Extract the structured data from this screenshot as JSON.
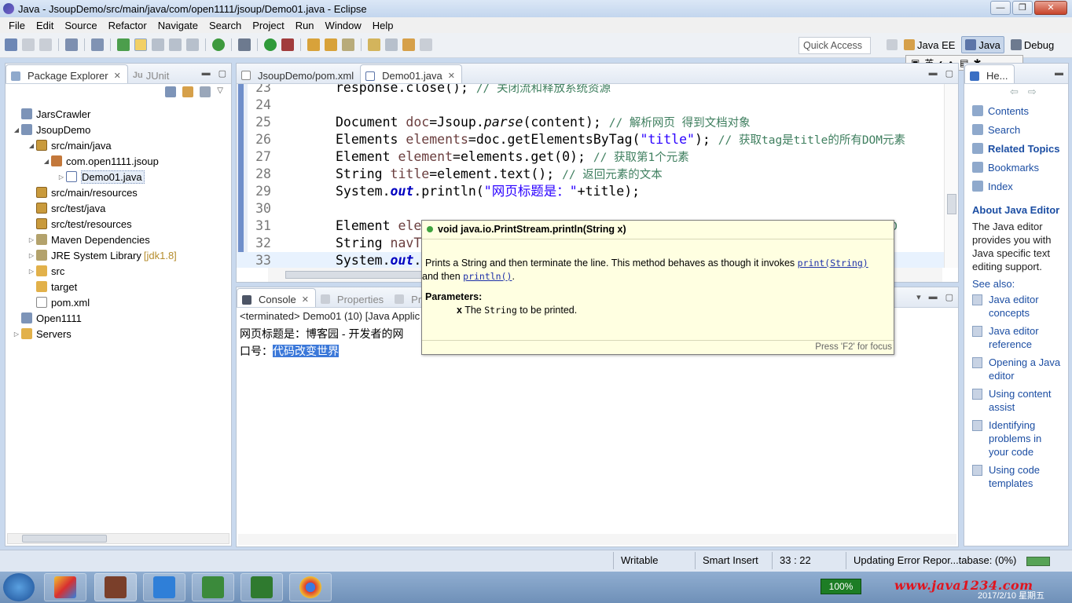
{
  "window": {
    "title": "Java - JsoupDemo/src/main/java/com/open1111/jsoup/Demo01.java - Eclipse",
    "buttons": [
      "—",
      "❐",
      "✕"
    ]
  },
  "menu": [
    "File",
    "Edit",
    "Source",
    "Refactor",
    "Navigate",
    "Search",
    "Project",
    "Run",
    "Window",
    "Help"
  ],
  "toolbar": {
    "quick_access": "Quick Access",
    "perspectives": [
      "Java EE",
      "Java",
      "Debug"
    ]
  },
  "ime": {
    "items": [
      "英"
    ]
  },
  "explorer": {
    "tabs": [
      "Package Explorer",
      "JUnit"
    ],
    "tree": [
      {
        "label": "JarsCrawler",
        "level": 0,
        "icon": "project-icon",
        "twisty": ""
      },
      {
        "label": "JsoupDemo",
        "level": 0,
        "icon": "project-icon",
        "twisty": "◢"
      },
      {
        "label": "src/main/java",
        "level": 1,
        "icon": "source-folder-icon",
        "twisty": "◢"
      },
      {
        "label": "com.open1111.jsoup",
        "level": 2,
        "icon": "package-icon",
        "twisty": "◢"
      },
      {
        "label": "Demo01.java",
        "level": 3,
        "icon": "java-file-icon",
        "twisty": "▷"
      },
      {
        "label": "src/main/resources",
        "level": 1,
        "icon": "source-folder-icon",
        "twisty": ""
      },
      {
        "label": "src/test/java",
        "level": 1,
        "icon": "source-folder-icon",
        "twisty": ""
      },
      {
        "label": "src/test/resources",
        "level": 1,
        "icon": "source-folder-icon",
        "twisty": ""
      },
      {
        "label": "Maven Dependencies",
        "level": 1,
        "icon": "library-icon",
        "twisty": "▷"
      },
      {
        "label": "JRE System Library",
        "level": 1,
        "icon": "library-icon",
        "twisty": "▷",
        "suffix": "[jdk1.8]"
      },
      {
        "label": "src",
        "level": 1,
        "icon": "folder-icon",
        "twisty": "▷"
      },
      {
        "label": "target",
        "level": 1,
        "icon": "folder-icon",
        "twisty": ""
      },
      {
        "label": "pom.xml",
        "level": 1,
        "icon": "xml-file-icon",
        "twisty": ""
      },
      {
        "label": "Open1111",
        "level": 0,
        "icon": "project-icon",
        "twisty": ""
      },
      {
        "label": "Servers",
        "level": 0,
        "icon": "folder-icon",
        "twisty": "▷"
      }
    ]
  },
  "editor": {
    "tabs": [
      "JsoupDemo/pom.xml",
      "Demo01.java"
    ],
    "lines": [
      {
        "n": "23",
        "parts": [
          {
            "t": "response.close(); ",
            "c": ""
          },
          {
            "t": "// 关闭流和释放系统资源",
            "c": "cmt"
          }
        ]
      },
      {
        "n": "24",
        "parts": []
      },
      {
        "n": "25",
        "parts": [
          {
            "t": "Document ",
            "c": ""
          },
          {
            "t": "doc",
            "c": "var"
          },
          {
            "t": "=Jsoup.",
            "c": ""
          },
          {
            "t": "parse",
            "c": "itl"
          },
          {
            "t": "(content); ",
            "c": ""
          },
          {
            "t": "// 解析网页 得到文档对象",
            "c": "cmt"
          }
        ]
      },
      {
        "n": "26",
        "parts": [
          {
            "t": "Elements ",
            "c": ""
          },
          {
            "t": "elements",
            "c": "var"
          },
          {
            "t": "=doc.getElementsByTag(",
            "c": ""
          },
          {
            "t": "\"title\"",
            "c": "kw-str"
          },
          {
            "t": "); ",
            "c": ""
          },
          {
            "t": "// 获取tag是title的所有DOM元素",
            "c": "cmt"
          }
        ]
      },
      {
        "n": "27",
        "parts": [
          {
            "t": "Element ",
            "c": ""
          },
          {
            "t": "element",
            "c": "var"
          },
          {
            "t": "=elements.get(0); ",
            "c": ""
          },
          {
            "t": "// 获取第1个元素",
            "c": "cmt"
          }
        ]
      },
      {
        "n": "28",
        "parts": [
          {
            "t": "String ",
            "c": ""
          },
          {
            "t": "title",
            "c": "var"
          },
          {
            "t": "=element.text(); ",
            "c": ""
          },
          {
            "t": "// 返回元素的文本",
            "c": "cmt"
          }
        ]
      },
      {
        "n": "29",
        "parts": [
          {
            "t": "System.",
            "c": ""
          },
          {
            "t": "out",
            "c": "static"
          },
          {
            "t": ".println(",
            "c": ""
          },
          {
            "t": "\"网页标题是：\"",
            "c": "kw-str"
          },
          {
            "t": "+title);",
            "c": ""
          }
        ]
      },
      {
        "n": "30",
        "parts": []
      },
      {
        "n": "31",
        "parts": [
          {
            "t": "Element ",
            "c": ""
          },
          {
            "t": "ele",
            "c": "var"
          },
          {
            "t": "                                                        ",
            "c": ""
          },
          {
            "t": "top的D",
            "c": "cmt"
          }
        ]
      },
      {
        "n": "32",
        "parts": [
          {
            "t": "String ",
            "c": ""
          },
          {
            "t": "navT",
            "c": "var"
          }
        ]
      },
      {
        "n": "33",
        "parts": [
          {
            "t": "System.",
            "c": ""
          },
          {
            "t": "out",
            "c": "static"
          },
          {
            "t": ".",
            "c": ""
          }
        ]
      }
    ]
  },
  "console": {
    "tabs": [
      "Console",
      "Properties",
      "Prob"
    ],
    "description": "<terminated> Demo01 (10) [Java Applic",
    "line1": "网页标题是：博客园 - 开发者的网",
    "line2_prefix": "口号：",
    "line2_selected": "代码改变世界"
  },
  "hover": {
    "signature": "void java.io.PrintStream.println(String x)",
    "desc_before": "Prints a String and then terminate the line. This method behaves as though it invokes ",
    "link1": "print(String)",
    "desc_mid": " and then ",
    "link2": "println()",
    "desc_after": ".",
    "params_label": "Parameters:",
    "param_name": "x",
    "param_desc_pre": " The ",
    "param_type": "String",
    "param_desc_post": " to be printed.",
    "footer": "Press 'F2' for focus"
  },
  "help": {
    "tab": "He...",
    "links": [
      "Contents",
      "Search",
      "Related Topics",
      "Bookmarks",
      "Index"
    ],
    "about_title": "About Java Editor",
    "about_text": "The Java editor provides you with Java specific text editing support.",
    "see_also": "See also:",
    "see_items": [
      "Java editor concepts",
      "Java editor reference",
      "Opening a Java editor",
      "Using content assist",
      "Identifying problems in your code",
      "Using code templates"
    ]
  },
  "status": {
    "mode": "Writable",
    "insert": "Smart Insert",
    "position": "33 : 22",
    "progress": "Updating Error Repor...tabase: (0%)"
  },
  "taskbar": {
    "battery": "100%",
    "watermark": "www.java1234.com",
    "date": "2017/2/10 星期五"
  }
}
